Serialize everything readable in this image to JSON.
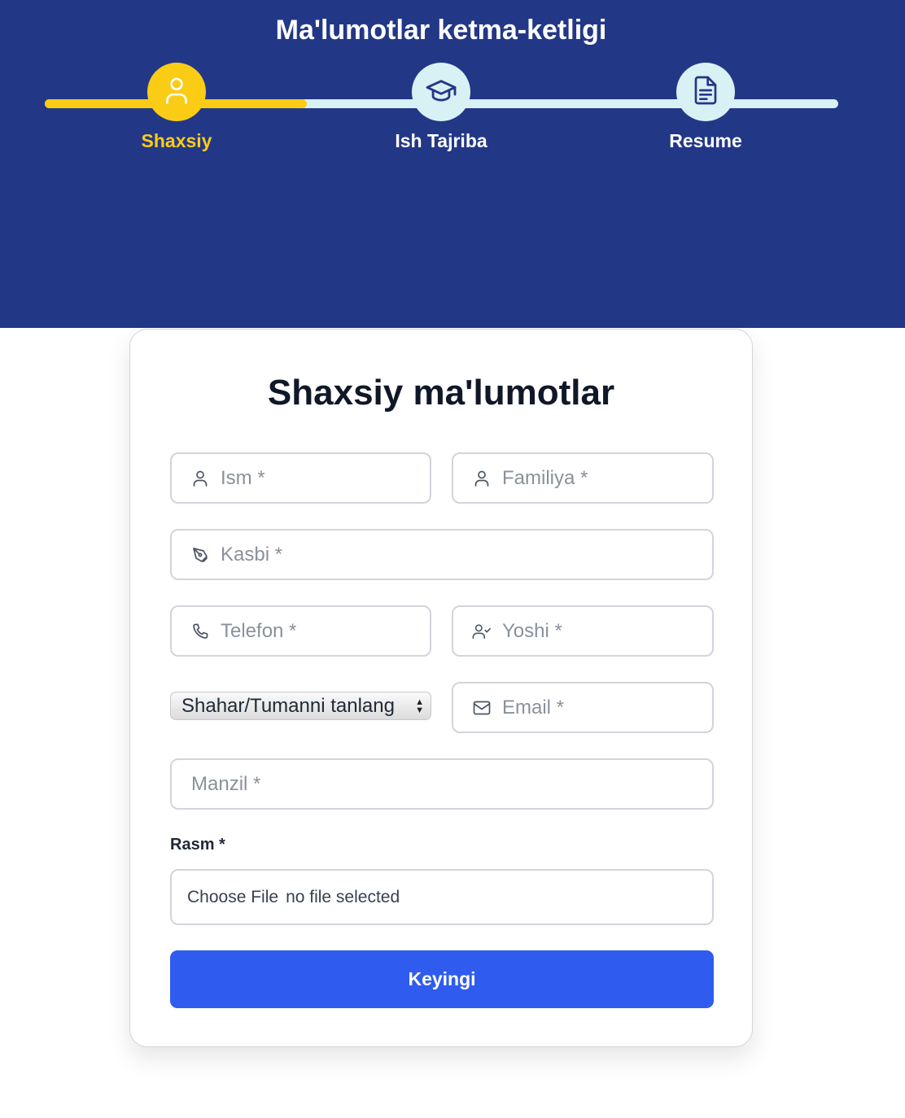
{
  "header": {
    "title": "Ma'lumotlar ketma-ketligi",
    "progress": 0.33,
    "steps": [
      {
        "label": "Shaxsiy",
        "icon": "user-icon",
        "active": true
      },
      {
        "label": "Ish Tajriba",
        "icon": "graduation-cap-icon",
        "active": false
      },
      {
        "label": "Resume",
        "icon": "document-icon",
        "active": false
      }
    ]
  },
  "colors": {
    "header_bg": "#233787",
    "accent_yellow": "#facc15",
    "track_light": "#d8f1f5",
    "button_blue": "#2f5cef"
  },
  "form": {
    "title": "Shaxsiy ma'lumotlar",
    "fields": {
      "ism": {
        "placeholder": "Ism *",
        "value": "",
        "icon": "user-icon"
      },
      "familiya": {
        "placeholder": "Familiya *",
        "value": "",
        "icon": "user-icon"
      },
      "kasbi": {
        "placeholder": "Kasbi *",
        "value": "",
        "icon": "pen-tool-icon"
      },
      "telefon": {
        "placeholder": "Telefon *",
        "value": "",
        "icon": "phone-icon"
      },
      "yoshi": {
        "placeholder": "Yoshi *",
        "value": "",
        "icon": "user-check-icon"
      },
      "email": {
        "placeholder": "Email *",
        "value": "",
        "icon": "mail-icon"
      },
      "manzil": {
        "placeholder": "Manzil *",
        "value": ""
      }
    },
    "city_select": {
      "selected": "Shahar/Tumanni tanlang"
    },
    "photo": {
      "label": "Rasm *",
      "button_label": "Choose File",
      "status": "no file selected"
    },
    "submit_label": "Keyingi"
  }
}
